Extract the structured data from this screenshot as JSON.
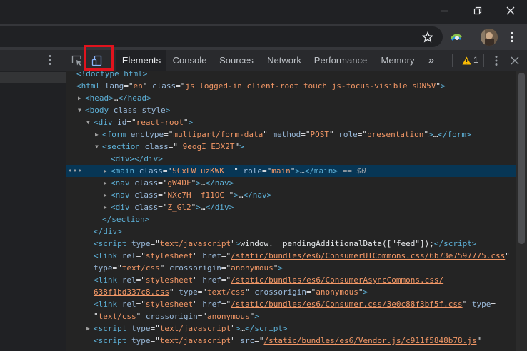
{
  "devtools": {
    "tabs": [
      "Elements",
      "Console",
      "Sources",
      "Network",
      "Performance",
      "Memory"
    ],
    "active_tab": "Elements",
    "more_tabs_glyph": "»",
    "warnings_count": "1"
  },
  "elements": {
    "lines": [
      {
        "toggle": "",
        "html": "<span class='t'>&lt;!doctype html&gt;</span>"
      },
      {
        "toggle": "",
        "html": "<span class='t'>&lt;html</span> <span class='a'>lang</span><span class='p'>=\"</span><span class='v'>en</span><span class='p'>\"</span> <span class='a'>class</span><span class='p'>=\"</span><span class='v'>js logged-in client-root touch js-focus-visible sDN5V</span><span class='p'>\"</span><span class='t'>&gt;</span>"
      },
      {
        "toggle": "closed",
        "html": "<span class='t'>&lt;head&gt;</span><span class='p'>…</span><span class='t'>&lt;/head&gt;</span>"
      },
      {
        "toggle": "open",
        "html": "<span class='t'>&lt;body</span> <span class='a'>class style</span><span class='t'>&gt;</span>"
      },
      {
        "toggle": "open",
        "html": "<span class='t'>&lt;div</span> <span class='a'>id</span><span class='p'>=\"</span><span class='v'>react-root</span><span class='p'>\"</span><span class='t'>&gt;</span>"
      },
      {
        "toggle": "closed",
        "html": "<span class='t'>&lt;form</span> <span class='a'>enctype</span><span class='p'>=\"</span><span class='v'>multipart/form-data</span><span class='p'>\"</span> <span class='a'>method</span><span class='p'>=\"</span><span class='v'>POST</span><span class='p'>\"</span> <span class='a'>role</span><span class='p'>=\"</span><span class='v'>presentation</span><span class='p'>\"</span><span class='t'>&gt;</span><span class='p'>…</span><span class='t'>&lt;/form&gt;</span>"
      },
      {
        "toggle": "open",
        "html": "<span class='t'>&lt;section</span> <span class='a'>class</span><span class='p'>=\"</span><span class='v'>_9eogI E3X2T</span><span class='p'>\"</span><span class='t'>&gt;</span>"
      },
      {
        "toggle": "",
        "html": "<span class='t'>&lt;div&gt;&lt;/div&gt;</span>"
      },
      {
        "toggle": "closed",
        "selected": true,
        "html": "<span class='t'>&lt;main</span> <span class='a'>class</span><span class='p'>=\"</span><span class='v'>SCxLW uzKWK  </span><span class='p'>\"</span> <span class='a'>role</span><span class='p'>=\"</span><span class='v'>main</span><span class='p'>\"</span><span class='t'>&gt;</span><span class='p'>…</span><span class='t'>&lt;/main&gt;</span> <span class='d'>== $0</span>"
      },
      {
        "toggle": "closed",
        "html": "<span class='t'>&lt;nav</span> <span class='a'>class</span><span class='p'>=\"</span><span class='v'>gW4DF</span><span class='p'>\"</span><span class='t'>&gt;</span><span class='p'>…</span><span class='t'>&lt;/nav&gt;</span>"
      },
      {
        "toggle": "closed",
        "html": "<span class='t'>&lt;nav</span> <span class='a'>class</span><span class='p'>=\"</span><span class='v'>NXc7H  f11OC </span><span class='p'>\"</span><span class='t'>&gt;</span><span class='p'>…</span><span class='t'>&lt;/nav&gt;</span>"
      },
      {
        "toggle": "closed",
        "html": "<span class='t'>&lt;div</span> <span class='a'>class</span><span class='p'>=\"</span><span class='v'>Z_Gl2</span><span class='p'>\"</span><span class='t'>&gt;</span><span class='p'>…</span><span class='t'>&lt;/div&gt;</span>"
      },
      {
        "toggle": "",
        "html": "<span class='t'>&lt;/section&gt;</span>"
      },
      {
        "toggle": "",
        "html": "<span class='t'>&lt;/div&gt;</span>"
      },
      {
        "toggle": "",
        "html": "<span class='t'>&lt;script</span> <span class='a'>type</span><span class='p'>=\"</span><span class='v'>text/javascript</span><span class='p'>\"</span><span class='t'>&gt;</span><span class='p'>window.__pendingAdditionalData([\"feed\"]);</span><span class='t'>&lt;/script&gt;</span>"
      },
      {
        "toggle": "",
        "html": "<span class='t'>&lt;link</span> <span class='a'>rel</span><span class='p'>=\"</span><span class='v'>stylesheet</span><span class='p'>\"</span> <span class='a'>href</span><span class='p'>=\"</span><span class='u'>/static/bundles/es6/ConsumerUICommons.css/6b73e7597775.css</span><span class='p'>\"</span>"
      },
      {
        "toggle": "",
        "html": "<span class='a'>type</span><span class='p'>=\"</span><span class='v'>text/css</span><span class='p'>\"</span> <span class='a'>crossorigin</span><span class='p'>=\"</span><span class='v'>anonymous</span><span class='p'>\"</span><span class='t'>&gt;</span>"
      },
      {
        "toggle": "",
        "html": "<span class='t'>&lt;link</span> <span class='a'>rel</span><span class='p'>=\"</span><span class='v'>stylesheet</span><span class='p'>\"</span> <span class='a'>href</span><span class='p'>=\"</span><span class='u'>/static/bundles/es6/ConsumerAsyncCommons.css/</span>"
      },
      {
        "toggle": "",
        "html": "<span class='u'>638f1bd337c8.css</span><span class='p'>\"</span> <span class='a'>type</span><span class='p'>=\"</span><span class='v'>text/css</span><span class='p'>\"</span> <span class='a'>crossorigin</span><span class='p'>=\"</span><span class='v'>anonymous</span><span class='p'>\"</span><span class='t'>&gt;</span>"
      },
      {
        "toggle": "",
        "html": "<span class='t'>&lt;link</span> <span class='a'>rel</span><span class='p'>=\"</span><span class='v'>stylesheet</span><span class='p'>\"</span> <span class='a'>href</span><span class='p'>=\"</span><span class='u'>/static/bundles/es6/Consumer.css/3e0c88f3bf5f.css</span><span class='p'>\"</span> <span class='a'>type</span><span class='p'>=</span>"
      },
      {
        "toggle": "",
        "html": "<span class='p'>\"</span><span class='v'>text/css</span><span class='p'>\"</span> <span class='a'>crossorigin</span><span class='p'>=\"</span><span class='v'>anonymous</span><span class='p'>\"</span><span class='t'>&gt;</span>"
      },
      {
        "toggle": "closed",
        "html": "<span class='t'>&lt;script</span> <span class='a'>type</span><span class='p'>=\"</span><span class='v'>text/javascript</span><span class='p'>\"</span><span class='t'>&gt;</span><span class='p'>…</span><span class='t'>&lt;/script&gt;</span>"
      },
      {
        "toggle": "",
        "html": "<span class='t'>&lt;script</span> <span class='a'>type</span><span class='p'>=\"</span><span class='v'>text/javascript</span><span class='p'>\"</span> <span class='a'>src</span><span class='p'>=\"</span><span class='u'>/static/bundles/es6/Vendor.js/c911f5848b78.js</span><span class='p'>\"</span>"
      }
    ]
  },
  "colors": {
    "highlight": "#e1131d",
    "selected_row": "#073655",
    "tag": "#5db0d7",
    "attr_name": "#9bbbdc",
    "attr_value": "#f29766"
  }
}
